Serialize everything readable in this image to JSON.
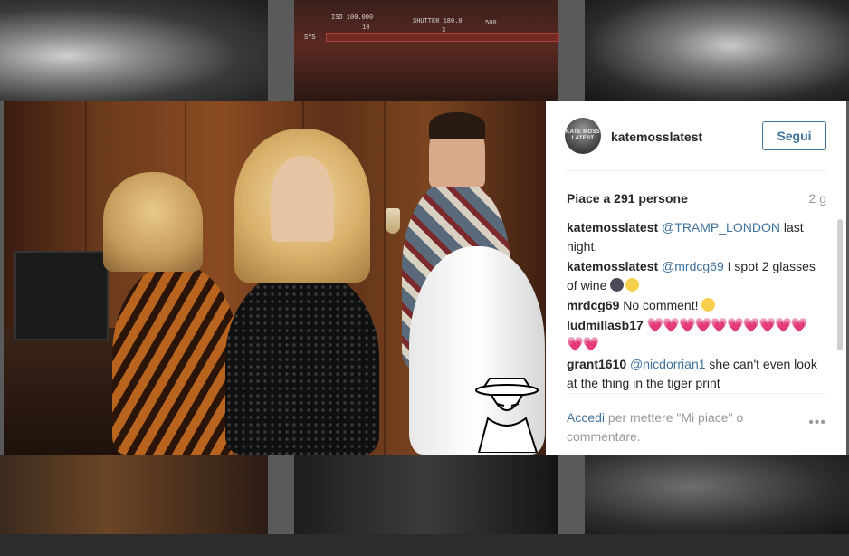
{
  "camera_overlay": {
    "iso": "ISO 100.000",
    "shutter": "SHUTTER 180.0",
    "value_500": "500",
    "value_10": "10",
    "value_3": "3",
    "sys": "SYS"
  },
  "post": {
    "username": "katemosslatest",
    "avatar_text": "KATE MOSS LATEST",
    "follow_label": "Segui",
    "likes": "Piace a 291 persone",
    "time_ago": "2 g",
    "comments": [
      {
        "user": "katemosslatest",
        "mention": "@TRAMP_LONDON",
        "text": " last night.",
        "emojis": []
      },
      {
        "user": "katemosslatest",
        "mention": "@mrdcg69",
        "text": " I spot 2 glasses of wine ",
        "emojis": [
          "dark-face-emoji",
          "smirk-emoji"
        ]
      },
      {
        "user": "mrdcg69",
        "mention": "",
        "text": " No comment! ",
        "emojis": [
          "tongue-wink-emoji"
        ]
      },
      {
        "user": "ludmillasb17",
        "mention": "",
        "text": " ",
        "hearts": "💗💗💗💗💗💗💗💗💗💗💗💗"
      },
      {
        "user": "grant1610",
        "mention": "@nicdorrian1",
        "text": " she can't even look at the thing in the tiger print",
        "emojis": []
      }
    ],
    "login_link": "Accedi",
    "login_text": " per mettere \"Mi piace\" o commentare.",
    "more_label": "•••"
  },
  "colors": {
    "link": "#3f729b",
    "text": "#262626",
    "muted": "#999999"
  }
}
